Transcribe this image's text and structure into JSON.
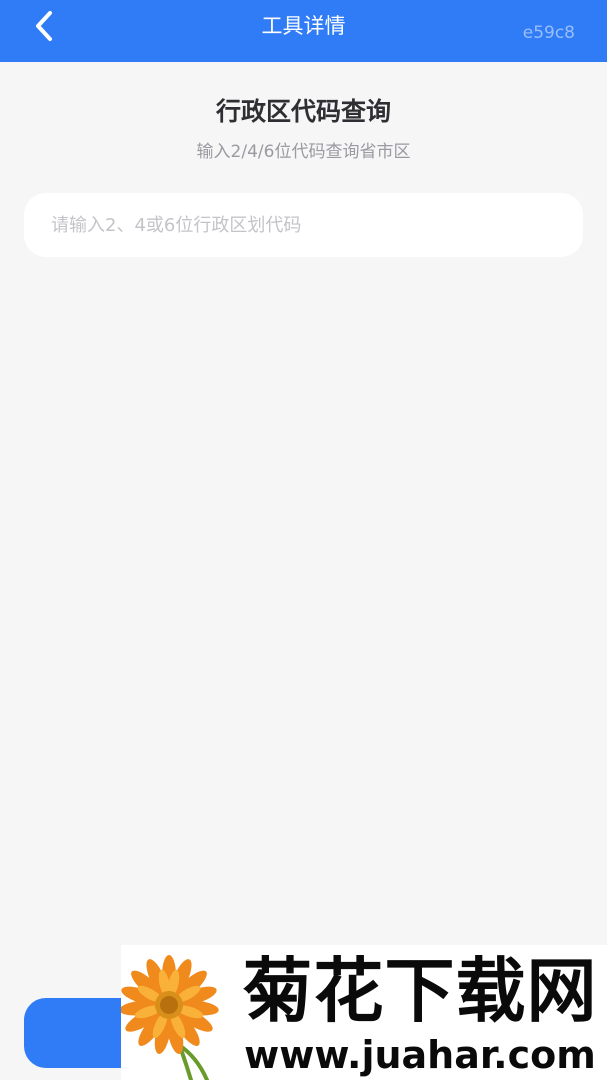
{
  "navbar": {
    "title": "工具详情",
    "tag": "e59c8",
    "back_icon": "chevron-left-icon",
    "background": "#2f7cf6"
  },
  "tool": {
    "title": "行政区代码查询",
    "subtitle": "输入2/4/6位代码查询省市区"
  },
  "search": {
    "placeholder": "请输入2、4或6位行政区划代码",
    "value": ""
  },
  "watermark": {
    "title": "菊花下载网",
    "url": "www.juahar.com",
    "icon": "flower-icon"
  }
}
